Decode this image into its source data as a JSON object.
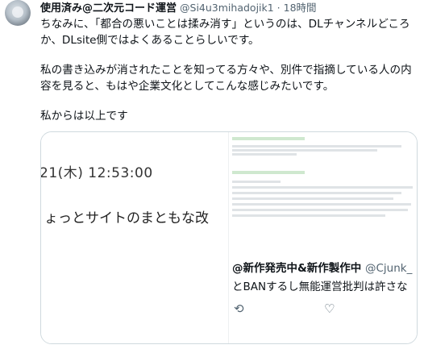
{
  "tweet": {
    "author_name": "使用済み@二次元コード運営",
    "handle_time": "@Si4u3mihadojik1 · 18時間",
    "paragraphs": [
      "ちなみに、「都合の悪いことは揉み消す」というのは、DLチャンネルどころか、DLsite側ではよくあることらしいです。",
      "私の書き込みが消されたことを知ってる方々や、別件で指摘している人の内容を見ると、もはや企業文化としてこんな感じみたいです。",
      "私からは以上です"
    ]
  },
  "media": {
    "left": {
      "date_text": "21(木) 12:53:00",
      "body_text": "ょっとサイトのまともな改"
    },
    "right": {
      "reply_author": "@新作発売中&新作製作中",
      "reply_handle": "@Cjunk_",
      "reply_text": "とBANするし無能運営批判は許さな",
      "retweet_icon": "retweet-icon",
      "like_icon": "heart-icon"
    }
  }
}
